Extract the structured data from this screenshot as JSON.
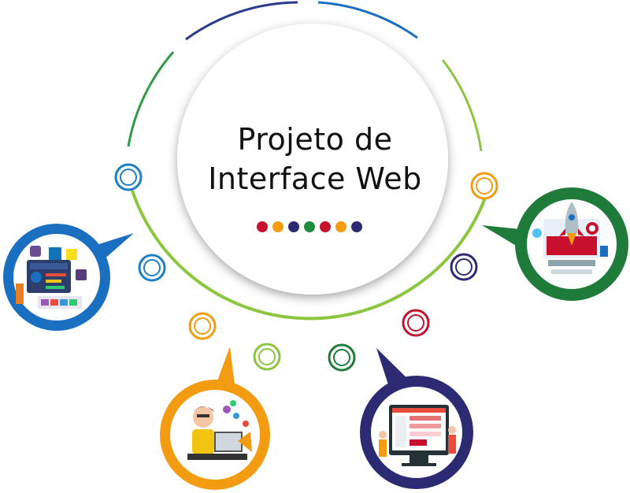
{
  "diagram": {
    "title_line1": "Projeto de",
    "title_line2": "Interface Web",
    "dot_colors": [
      "#c8102e",
      "#f39c12",
      "#2b2a73",
      "#1e8c3a",
      "#c8102e",
      "#f39c12",
      "#2b2a73"
    ],
    "colors": {
      "green": "#8cc63f",
      "dark_green": "#1e7b3a",
      "blue": "#1a6fc0",
      "navy": "#2b2a73",
      "orange": "#f39c12",
      "red": "#c8102e"
    },
    "nodes": [
      {
        "name": "node-blue-1",
        "color": "#1a7fc4"
      },
      {
        "name": "node-blue-2",
        "color": "#1a7fc4"
      },
      {
        "name": "node-orange",
        "color": "#f39c12"
      },
      {
        "name": "node-green-1",
        "color": "#8cc63f"
      },
      {
        "name": "node-green-2",
        "color": "#1e7b3a"
      },
      {
        "name": "node-red",
        "color": "#c8102e"
      },
      {
        "name": "node-navy",
        "color": "#2b2a73"
      },
      {
        "name": "node-orange-2",
        "color": "#f39c12"
      }
    ],
    "bubbles": [
      {
        "name": "bubble-web-technologies",
        "icon": "code-languages-icon",
        "color": "#1a6fc0"
      },
      {
        "name": "bubble-developer",
        "icon": "developer-icon",
        "color": "#f39c12"
      },
      {
        "name": "bubble-web-design",
        "icon": "web-design-icon",
        "color": "#2b2a73"
      },
      {
        "name": "bubble-launch",
        "icon": "rocket-launch-icon",
        "color": "#1e7b3a"
      }
    ]
  }
}
